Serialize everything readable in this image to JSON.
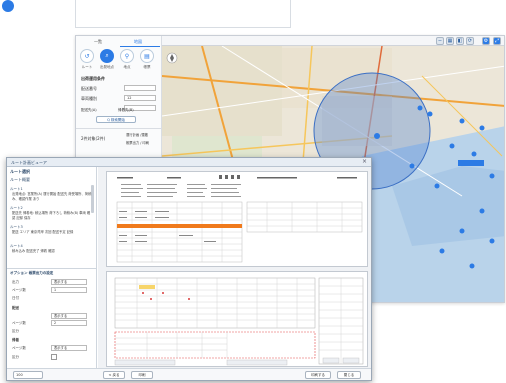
{
  "map_window": {
    "tabs": [
      "一覧",
      "地図"
    ],
    "nav": [
      {
        "label": "ルート",
        "icon": "route-icon"
      },
      {
        "label": "出発地点",
        "icon": "search-icon"
      },
      {
        "label": "地点",
        "icon": "pin-icon"
      },
      {
        "label": "帳票",
        "icon": "document-icon"
      }
    ],
    "section_title": "出荷運用条件",
    "fields": [
      {
        "label": "配送番号",
        "value": ""
      },
      {
        "label": "車両種別",
        "value": "12"
      },
      {
        "label": "",
        "value": ""
      }
    ],
    "checks": [
      "配送先(A)",
      "帰着先(B)"
    ],
    "search_button": "Q 検索開始",
    "bottom_left": "2件対象(2件)",
    "bottom_right_1": "運行計画 /運搬",
    "bottom_right_2": "帳票出力 / 印刷"
  },
  "doc_window": {
    "title": "ルート計画ビューア",
    "left_heading": "ルート選択",
    "left_sub": "ルート概要",
    "left_blocks": [
      {
        "head": "ルート1",
        "text": "出発地点: 営業所(A) 運行開始 配送先 荷受場所、荷積み、確認作業 あり"
      },
      {
        "head": "ルート2",
        "text": "配送先 帰着地: 積込場所 荷下ろし 荷積み(B) 車両 確認 記録 保存"
      },
      {
        "head": "ルート3",
        "text": "配送 エリア 東京湾岸 次回 配送予定 記録"
      },
      {
        "head": "ルート4",
        "text": "積み込み 配送完了 帰着 確認"
      }
    ],
    "options_heading": "オプション 帳票出力の設定",
    "options": [
      {
        "label": "出力",
        "value": "表示する"
      },
      {
        "label": "ページ数",
        "value": "1"
      },
      {
        "label": "日付",
        "value": ""
      },
      {
        "label": "配送",
        "value": "表示する"
      },
      {
        "label": "ページ数",
        "value": "2"
      },
      {
        "label": "区分",
        "value": ""
      },
      {
        "label": "帰着",
        "value": ""
      },
      {
        "label": "ページ数",
        "value": "表示する"
      },
      {
        "label": "区分",
        "value": ""
      }
    ],
    "zoom": "100",
    "footer_buttons": [
      "< 戻る",
      "印刷",
      "印刷する",
      "閉じる"
    ]
  }
}
